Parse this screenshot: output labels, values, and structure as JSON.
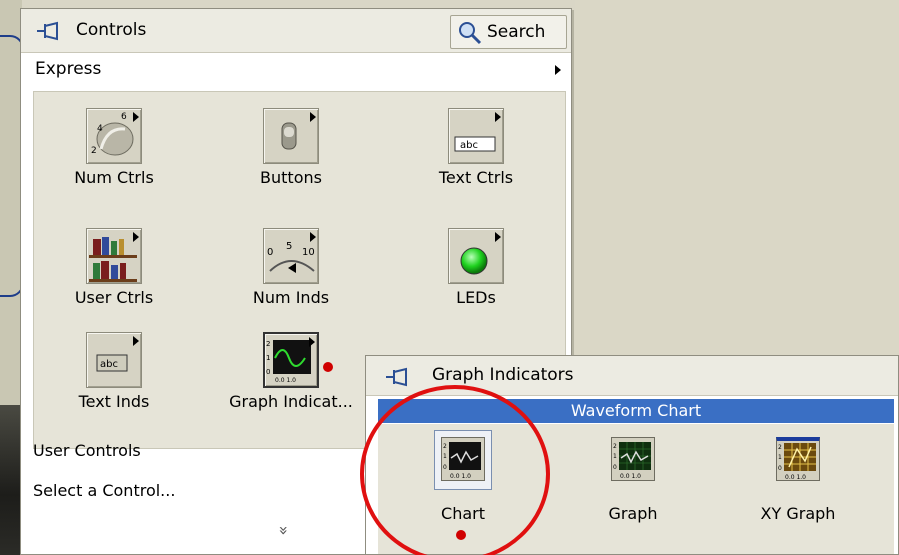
{
  "palette": {
    "title": "Controls",
    "search_label": "Search",
    "express_label": "Express",
    "tiles": [
      {
        "label": "Num Ctrls"
      },
      {
        "label": "Buttons"
      },
      {
        "label": "Text Ctrls"
      },
      {
        "label": "User Ctrls"
      },
      {
        "label": "Num Inds"
      },
      {
        "label": "LEDs"
      },
      {
        "label": "Text Inds"
      },
      {
        "label": "Graph Indicat..."
      }
    ],
    "tile_icons": [
      "knob-icon",
      "toggle-switch-icon",
      "string-control-icon",
      "books-icon",
      "slide-gauge-icon",
      "led-icon",
      "string-indicator-icon",
      "graph-icon"
    ],
    "num_inds_gauge_labels": [
      "0",
      "5",
      "10"
    ],
    "text_icon_label": "abc",
    "user_controls_label": "User Controls",
    "select_control_label": "Select a Control...",
    "more_symbol": "»"
  },
  "subpalette": {
    "title": "Graph Indicators",
    "selected_item": "Waveform Chart",
    "items": [
      {
        "label": "Chart"
      },
      {
        "label": "Graph"
      },
      {
        "label": "XY Graph"
      }
    ],
    "item_icons": [
      "waveform-chart-icon",
      "waveform-graph-icon",
      "xy-graph-icon"
    ]
  },
  "colors": {
    "selection": "#3a6fc4",
    "highlight_circle": "#e01010",
    "led_green": "#1fd21f",
    "callout_border": "#1e3d8a"
  }
}
